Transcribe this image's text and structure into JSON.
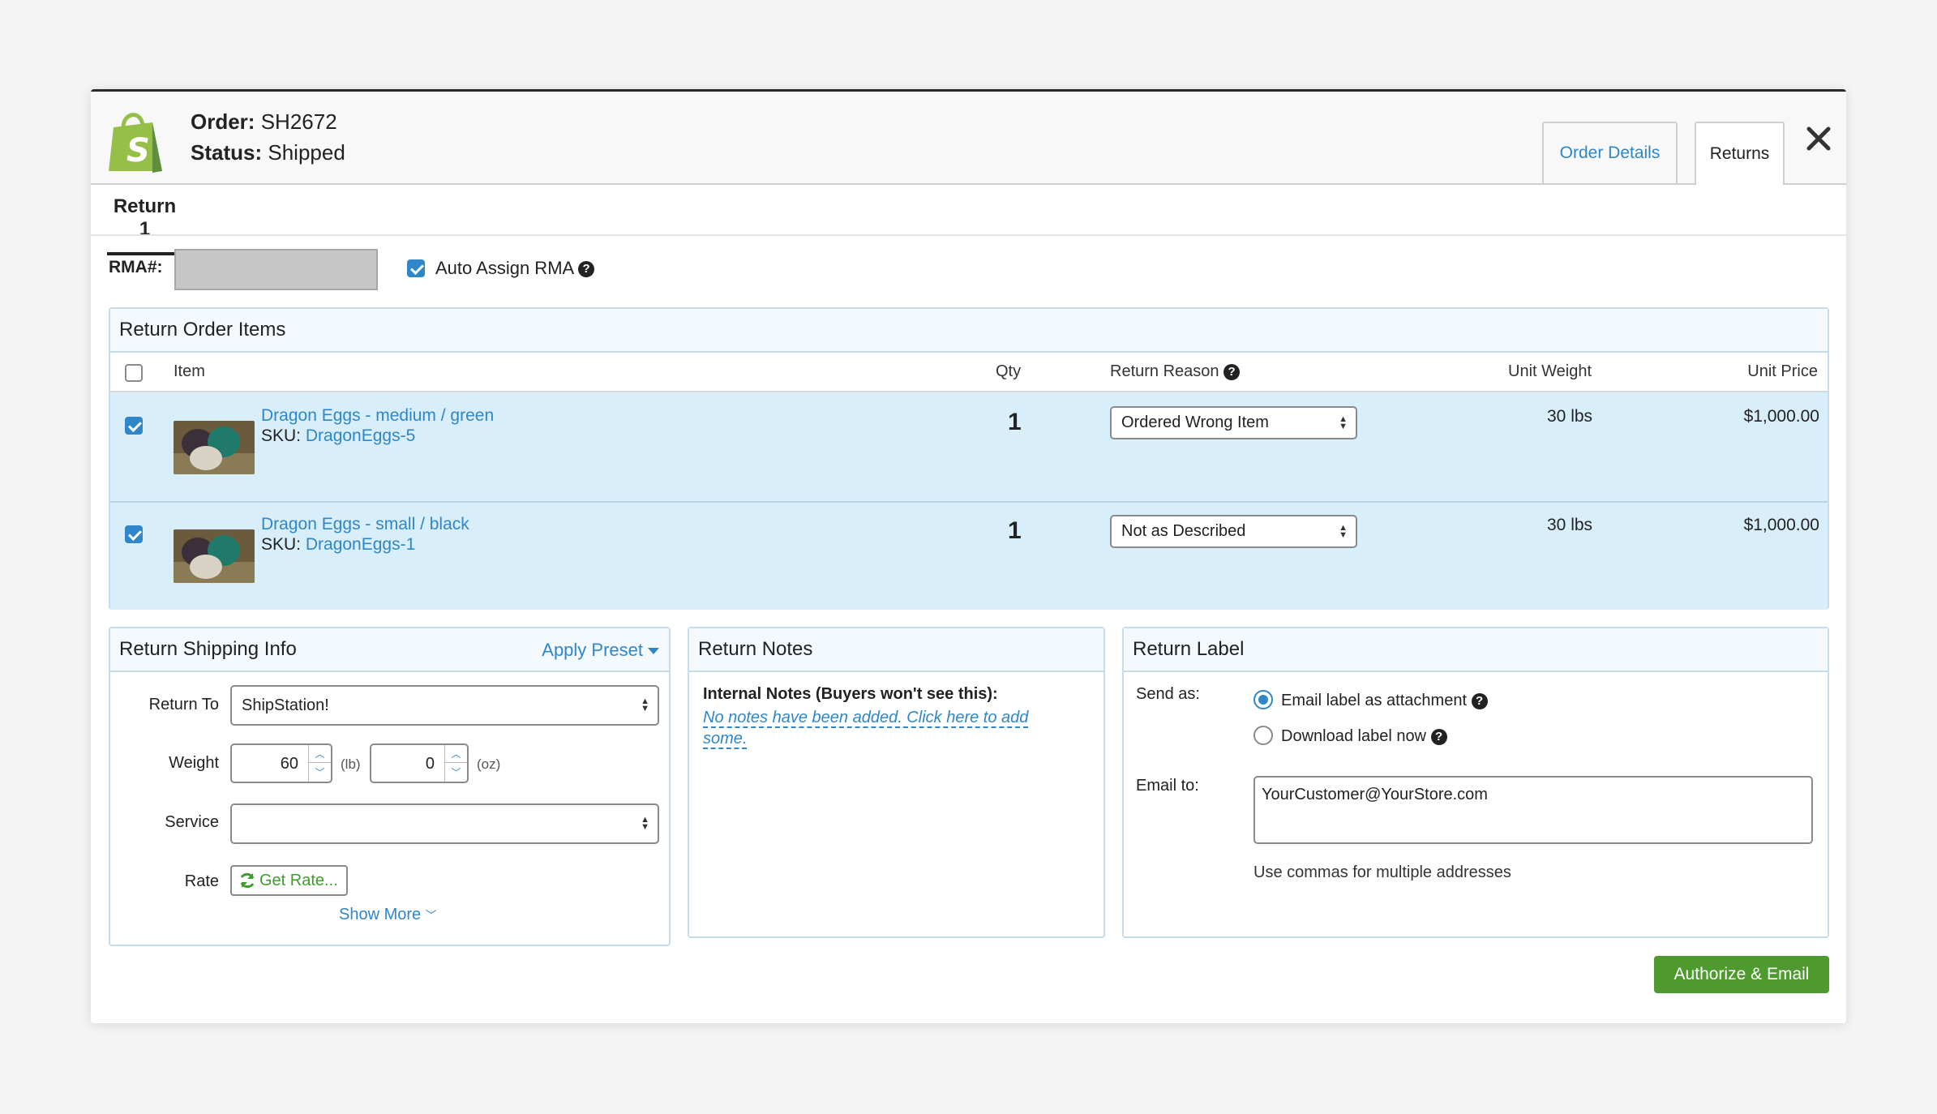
{
  "header": {
    "order_label": "Order:",
    "order_value": "SH2672",
    "status_label": "Status:",
    "status_value": "Shipped",
    "tabs": [
      {
        "label": "Order Details",
        "active": false
      },
      {
        "label": "Returns",
        "active": true
      }
    ]
  },
  "subtabs": [
    {
      "label": "Return 1"
    }
  ],
  "rma": {
    "label": "RMA#:",
    "value": "",
    "auto_assign_label": "Auto Assign RMA",
    "auto_assign_checked": true
  },
  "items_panel": {
    "title": "Return Order Items",
    "columns": {
      "item": "Item",
      "qty": "Qty",
      "reason": "Return Reason",
      "weight": "Unit Weight",
      "price": "Unit Price"
    },
    "rows": [
      {
        "name": "Dragon Eggs - medium / green",
        "sku_label": "SKU:",
        "sku": "DragonEggs-5",
        "qty": "1",
        "reason": "Ordered Wrong Item",
        "weight": "30 lbs",
        "price": "$1,000.00",
        "checked": true
      },
      {
        "name": "Dragon Eggs - small / black",
        "sku_label": "SKU:",
        "sku": "DragonEggs-1",
        "qty": "1",
        "reason": "Not as Described",
        "weight": "30 lbs",
        "price": "$1,000.00",
        "checked": true
      }
    ]
  },
  "shipping": {
    "title": "Return Shipping Info",
    "apply_preset": "Apply Preset",
    "return_to_label": "Return To",
    "return_to_value": "ShipStation!",
    "weight_label": "Weight",
    "weight_lb": "60",
    "lb_unit": "(lb)",
    "weight_oz": "0",
    "oz_unit": "(oz)",
    "service_label": "Service",
    "service_value": "",
    "rate_label": "Rate",
    "get_rate": "Get Rate...",
    "show_more": "Show More"
  },
  "notes": {
    "title": "Return Notes",
    "internal_label": "Internal Notes (Buyers won't see this):",
    "empty_link": "No notes have been added. Click here to add some."
  },
  "label": {
    "title": "Return Label",
    "send_as_label": "Send as:",
    "option_email": "Email label as attachment",
    "option_download": "Download label now",
    "selected": "email",
    "email_to_label": "Email to:",
    "email_value": "YourCustomer@YourStore.com",
    "hint": "Use commas for multiple addresses"
  },
  "footer": {
    "authorize_button": "Authorize & Email"
  },
  "colors": {
    "link_blue": "#2f86c8",
    "row_highlight": "#d8eefa",
    "action_green": "#4e9a2f",
    "shopify_green": "#95bf47"
  }
}
